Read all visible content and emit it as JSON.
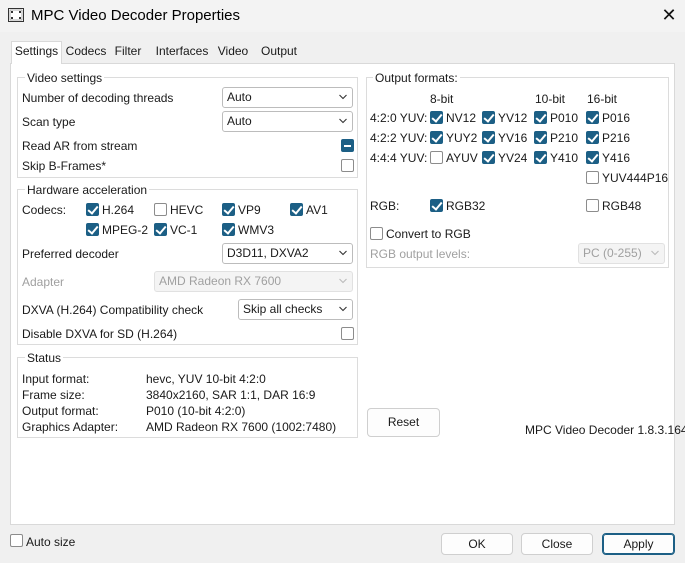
{
  "window": {
    "title": "MPC Video Decoder Properties",
    "close_glyph": "✕"
  },
  "tabs": [
    "Settings",
    "Codecs",
    "Filter",
    "Interfaces",
    "Video",
    "Output"
  ],
  "video_settings": {
    "title": "Video settings",
    "threads_label": "Number of decoding threads",
    "threads_value": "Auto",
    "scan_label": "Scan type",
    "scan_value": "Auto",
    "read_ar_label": "Read AR from stream",
    "skip_b_label": "Skip B-Frames*"
  },
  "hw": {
    "title": "Hardware acceleration",
    "codecs_label": "Codecs:",
    "codecs": [
      {
        "name": "H.264",
        "checked": true
      },
      {
        "name": "HEVC",
        "checked": false
      },
      {
        "name": "VP9",
        "checked": true
      },
      {
        "name": "AV1",
        "checked": true
      },
      {
        "name": "MPEG-2",
        "checked": true
      },
      {
        "name": "VC-1",
        "checked": true
      },
      {
        "name": "WMV3",
        "checked": true
      }
    ],
    "pref_label": "Preferred decoder",
    "pref_value": "D3D11, DXVA2",
    "adapter_label": "Adapter",
    "adapter_value": "AMD Radeon RX 7600",
    "compat_label": "DXVA (H.264) Compatibility check",
    "compat_value": "Skip all checks",
    "disable_sd_label": "Disable DXVA for SD (H.264)"
  },
  "status": {
    "title": "Status",
    "rows": [
      {
        "label": "Input format:",
        "value": "hevc, YUV 10-bit 4:2:0"
      },
      {
        "label": "Frame size:",
        "value": "3840x2160, SAR 1:1, DAR 16:9"
      },
      {
        "label": "Output format:",
        "value": "P010 (10-bit 4:2:0)"
      },
      {
        "label": "Graphics Adapter:",
        "value": "AMD Radeon RX 7600 (1002:7480)"
      }
    ]
  },
  "output": {
    "title": "Output formats:",
    "col_8bit": "8-bit",
    "col_10bit": "10-bit",
    "col_16bit": "16-bit",
    "row_420": "4:2:0 YUV:",
    "row_422": "4:2:2 YUV:",
    "row_444": "4:4:4 YUV:",
    "row_rgb": "RGB:",
    "formats": {
      "NV12": true,
      "YV12": true,
      "P010": true,
      "P016": true,
      "YUY2": true,
      "YV16": true,
      "P210": true,
      "P216": true,
      "AYUV": false,
      "YV24": true,
      "Y410": true,
      "Y416": true,
      "YUV444P16": false,
      "RGB32": true,
      "RGB48": false
    },
    "labels": {
      "NV12": "NV12",
      "YV12": "YV12",
      "P010": "P010",
      "P016": "P016",
      "YUY2": "YUY2",
      "YV16": "YV16",
      "P210": "P210",
      "P216": "P216",
      "AYUV": "AYUV",
      "YV24": "YV24",
      "Y410": "Y410",
      "Y416": "Y416",
      "YUV444P16": "YUV444P16",
      "RGB32": "RGB32",
      "RGB48": "RGB48"
    },
    "convert_label": "Convert to RGB",
    "levels_label": "RGB output levels:",
    "levels_value": "PC (0-255)"
  },
  "reset_label": "Reset",
  "version": "MPC Video Decoder 1.8.3.164",
  "auto_size_label": "Auto size",
  "buttons": {
    "ok": "OK",
    "close": "Close",
    "apply": "Apply"
  }
}
